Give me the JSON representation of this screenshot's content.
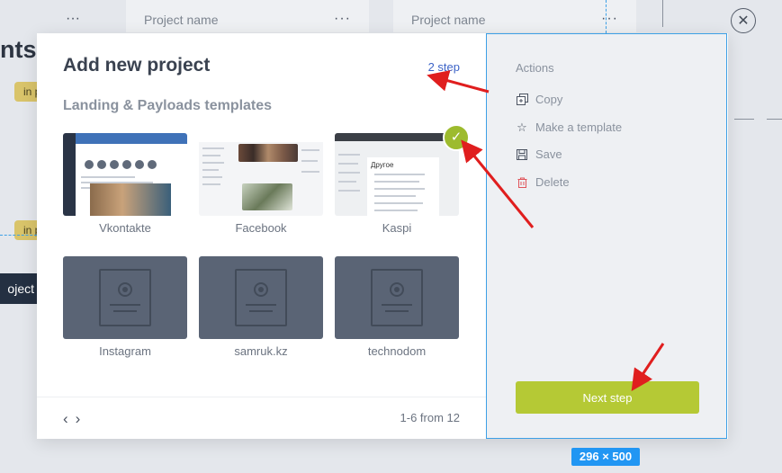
{
  "background": {
    "project_cards": [
      "Project name",
      "Project name"
    ],
    "card_menu_glyph": "···",
    "heading_fragment": "nts",
    "badge_fragment": "in p",
    "project_button_fragment": "oject"
  },
  "modal": {
    "title": "Add new project",
    "step": "2 step",
    "subtitle": "Landing & Payloads templates",
    "templates": [
      {
        "label": "Vkontakte",
        "selected": false
      },
      {
        "label": "Facebook",
        "selected": false
      },
      {
        "label": "Kaspi",
        "selected": true
      },
      {
        "label": "Instagram",
        "selected": false
      },
      {
        "label": "samruk.kz",
        "selected": false
      },
      {
        "label": "technodom",
        "selected": false
      }
    ],
    "kaspi_heading": "Другое",
    "pagination": {
      "prev": "‹",
      "next": "›",
      "count": "1-6 from 12"
    }
  },
  "actions_panel": {
    "heading": "Actions",
    "items": [
      {
        "label": "Copy",
        "icon": "copy-icon"
      },
      {
        "label": "Make a template",
        "icon": "star-icon"
      },
      {
        "label": "Save",
        "icon": "save-icon"
      },
      {
        "label": "Delete",
        "icon": "trash-icon"
      }
    ],
    "next_button": "Next step"
  },
  "size_badge": "296 × 500",
  "colors": {
    "accent": "#b5c935",
    "selected_check": "#9dbb2e",
    "link": "#3c63c7",
    "guide": "#3da0e6",
    "annotation_arrow": "#e01e1e"
  }
}
